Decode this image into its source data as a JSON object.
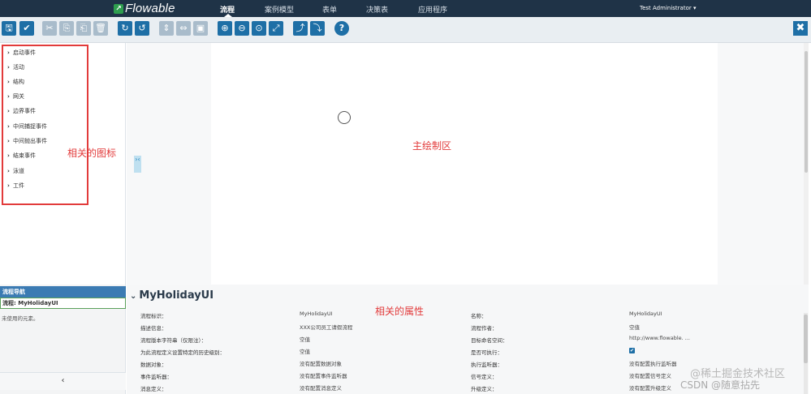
{
  "topbar": {
    "logo": "Flowable",
    "tabs": [
      {
        "label": "流程",
        "active": true
      },
      {
        "label": "案例模型",
        "active": false
      },
      {
        "label": "表单",
        "active": false
      },
      {
        "label": "决策表",
        "active": false
      },
      {
        "label": "应用程序",
        "active": false
      }
    ],
    "user": "Test Administrator ▾"
  },
  "toolbar": {
    "buttons": [
      {
        "icon": "save-icon",
        "glyph": "🖫",
        "enabled": true
      },
      {
        "icon": "check-icon",
        "glyph": "✔",
        "enabled": true
      },
      {
        "icon": "cut-icon",
        "glyph": "✂",
        "enabled": false
      },
      {
        "icon": "copy-icon",
        "glyph": "⎘",
        "enabled": false
      },
      {
        "icon": "paste-icon",
        "glyph": "⎗",
        "enabled": false
      },
      {
        "icon": "delete-icon",
        "glyph": "🗑",
        "enabled": false
      },
      {
        "icon": "redo-icon",
        "glyph": "↻",
        "enabled": true
      },
      {
        "icon": "undo-icon",
        "glyph": "↺",
        "enabled": true
      },
      {
        "icon": "align-vertical-icon",
        "glyph": "⇕",
        "enabled": false
      },
      {
        "icon": "align-horizontal-icon",
        "glyph": "⇔",
        "enabled": false
      },
      {
        "icon": "same-size-icon",
        "glyph": "▣",
        "enabled": false
      },
      {
        "icon": "zoom-in-icon",
        "glyph": "⊕",
        "enabled": true
      },
      {
        "icon": "zoom-out-icon",
        "glyph": "⊖",
        "enabled": true
      },
      {
        "icon": "zoom-actual-icon",
        "glyph": "⊙",
        "enabled": true
      },
      {
        "icon": "zoom-fit-icon",
        "glyph": "⤢",
        "enabled": true
      },
      {
        "icon": "bendpoint-add-icon",
        "glyph": "⤴",
        "enabled": true
      },
      {
        "icon": "bendpoint-remove-icon",
        "glyph": "⤵",
        "enabled": true
      },
      {
        "icon": "help-icon",
        "glyph": "?",
        "enabled": true
      }
    ],
    "close_glyph": "✖"
  },
  "palette": {
    "groups": [
      "启动事件",
      "活动",
      "结构",
      "网关",
      "边界事件",
      "中间捕捉事件",
      "中间抛出事件",
      "结束事件",
      "泳道",
      "工件"
    ],
    "annotation": "相关的图标"
  },
  "canvas": {
    "annotation": "主绘制区",
    "collapse_glyph": "›‹"
  },
  "outline": {
    "header": "流程导航",
    "process_label": "流程: MyHolidayUI",
    "empty_text": "未使用的元素。",
    "collapse_glyph": "‹"
  },
  "properties": {
    "title": "MyHolidayUI",
    "chevron": "⌄",
    "annotation": "相关的属性",
    "left": [
      {
        "label": "流程标识：",
        "value": "MyHolidayUI"
      },
      {
        "label": "描述信息：",
        "value": "XXX公司员工请假流程"
      },
      {
        "label": "流程版本字符串（仅限注）：",
        "value": "空值"
      },
      {
        "label": "为此流程定义设置特定的历史级别：",
        "value": "空值"
      },
      {
        "label": "数据对象：",
        "value": "没有配置数据对象"
      },
      {
        "label": "事件监听器：",
        "value": "没有配置事件监听器"
      },
      {
        "label": "消息定义：",
        "value": "没有配置消息定义"
      }
    ],
    "right": [
      {
        "label": "名称：",
        "value": "MyHolidayUI"
      },
      {
        "label": "流程作者：",
        "value": "空值"
      },
      {
        "label": "目标命名空间：",
        "value": "http://www.flowable. ..."
      },
      {
        "label": "是否可执行：",
        "value": "✔"
      },
      {
        "label": "执行监听器：",
        "value": "没有配置执行监听器"
      },
      {
        "label": "信号定义：",
        "value": "没有配置信号定义"
      },
      {
        "label": "升级定义：",
        "value": "没有配置升级定义"
      }
    ]
  },
  "watermark": {
    "line1": "@稀土掘金技术社区",
    "line2": "CSDN @随意拈先"
  }
}
